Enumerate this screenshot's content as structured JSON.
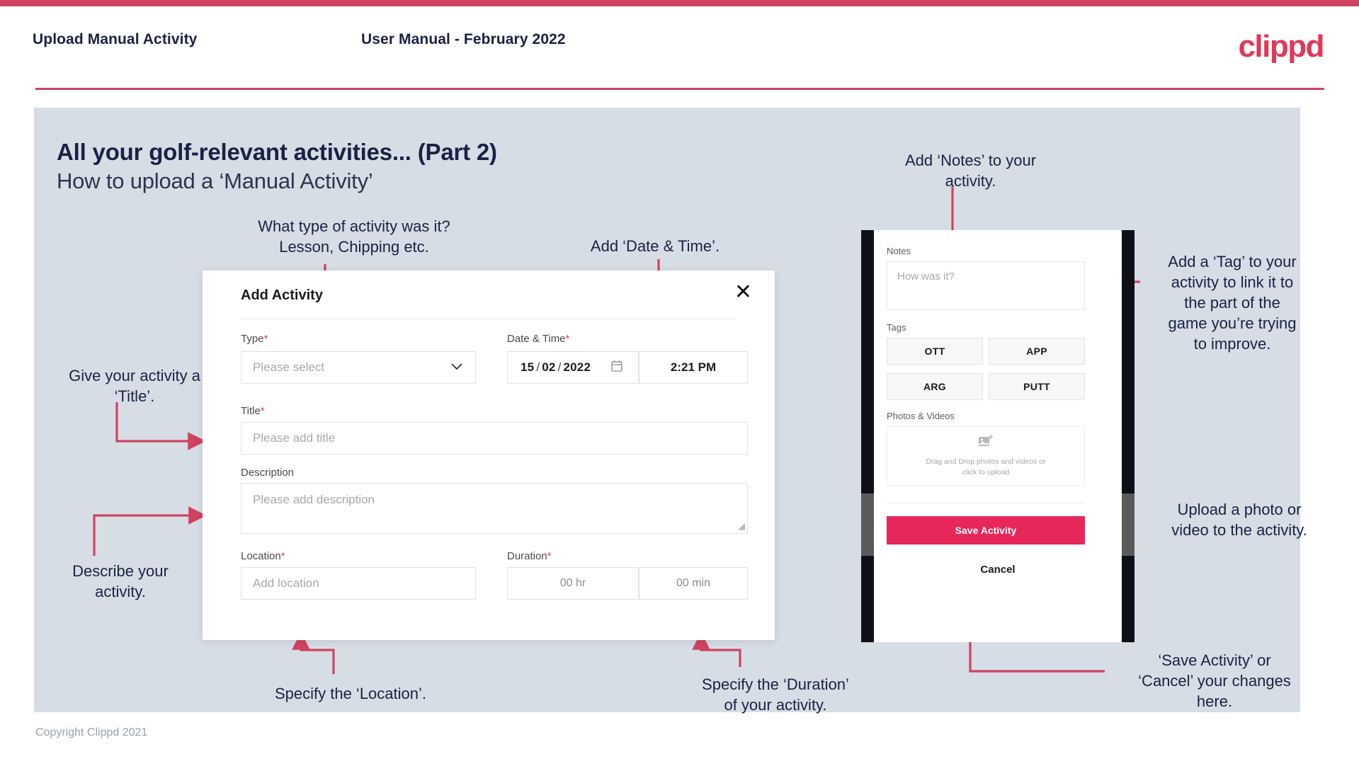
{
  "header": {
    "left_title": "Upload Manual Activity",
    "center_title": "User Manual - February 2022",
    "logo": "clippd"
  },
  "slide": {
    "title_line1": "All your golf-relevant activities... (Part 2)",
    "title_line2": "How to upload a ‘Manual Activity’",
    "copyright": "Copyright Clippd 2021"
  },
  "annotations": {
    "type": "What type of activity was it?\nLesson, Chipping etc.",
    "datetime": "Add ‘Date & Time’.",
    "title": "Give your activity a\n‘Title’.",
    "description": "Describe your\nactivity.",
    "location": "Specify the ‘Location’.",
    "duration": "Specify the ‘Duration’\nof your activity.",
    "notes": "Add ‘Notes’ to your\nactivity.",
    "tags": "Add a ‘Tag’ to your\nactivity to link it to\nthe part of the\ngame you’re trying\nto improve.",
    "photos": "Upload a photo or\nvideo to the activity.",
    "save_cancel": "‘Save Activity’ or\n‘Cancel’ your changes\nhere."
  },
  "dialog": {
    "title": "Add Activity",
    "close_icon": "close-icon",
    "fields": {
      "type": {
        "label": "Type",
        "required": "*",
        "placeholder": "Please select",
        "chevron_icon": "chevron-down-icon"
      },
      "datetime": {
        "label": "Date & Time",
        "required": "*",
        "day": "15",
        "month": "02",
        "year": "2022",
        "separator": "/",
        "calendar_icon": "calendar-icon",
        "time": "2:21 PM"
      },
      "title": {
        "label": "Title",
        "required": "*",
        "placeholder": "Please add title"
      },
      "description": {
        "label": "Description",
        "required": "",
        "placeholder": "Please add description"
      },
      "location": {
        "label": "Location",
        "required": "*",
        "placeholder": "Add location"
      },
      "duration": {
        "label": "Duration",
        "required": "*",
        "hours_placeholder": "00 hr",
        "minutes_placeholder": "00 min"
      }
    }
  },
  "phone": {
    "notes": {
      "label": "Notes",
      "placeholder": "How was it?"
    },
    "tags": {
      "label": "Tags",
      "items": [
        "OTT",
        "APP",
        "ARG",
        "PUTT"
      ]
    },
    "photos": {
      "label": "Photos & Videos",
      "icon": "add-image-icon",
      "drop_text": "Drag and Drop photos and videos or\nclick to upload"
    },
    "save_label": "Save Activity",
    "cancel_label": "Cancel"
  },
  "colors": {
    "brand_pink": "#e7275a",
    "stripe": "#cf4361",
    "slide_bg": "#d7dde5",
    "ink": "#182244",
    "arrow": "#cf4361"
  }
}
